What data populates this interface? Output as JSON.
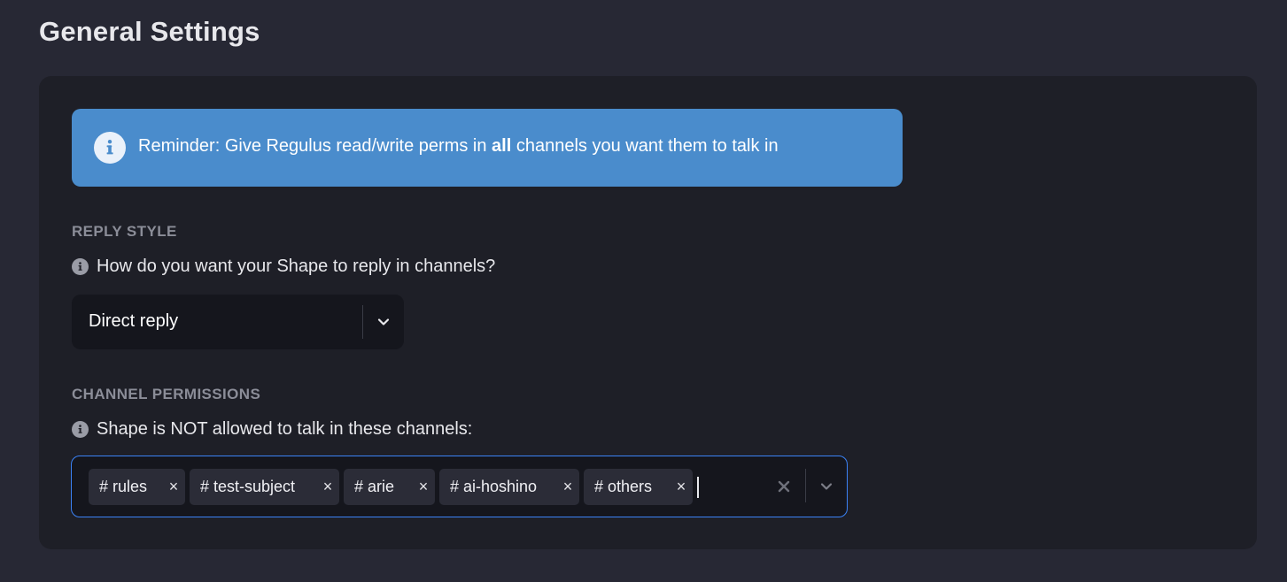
{
  "page": {
    "title": "General Settings"
  },
  "banner": {
    "icon": "info-icon",
    "text_before": "Reminder: Give Regulus read/write perms in ",
    "text_bold": "all",
    "text_after": " channels you want them to talk in",
    "color": "#4a8ccc"
  },
  "reply_style": {
    "section_label": "REPLY STYLE",
    "question": "How do you want your Shape to reply in channels?",
    "selected_value": "Direct reply",
    "dropdown_icon": "chevron-down-icon"
  },
  "channel_permissions": {
    "section_label": "CHANNEL PERMISSIONS",
    "question": "Shape is NOT allowed to talk in these channels:",
    "channels": [
      "# rules",
      "# test-subject",
      "# arie",
      "# ai-hoshino",
      "# others"
    ],
    "remove_symbol": "×",
    "clear_icon": "clear-x-icon",
    "dropdown_icon": "chevron-down-icon",
    "focus_color": "#3b82f6"
  }
}
